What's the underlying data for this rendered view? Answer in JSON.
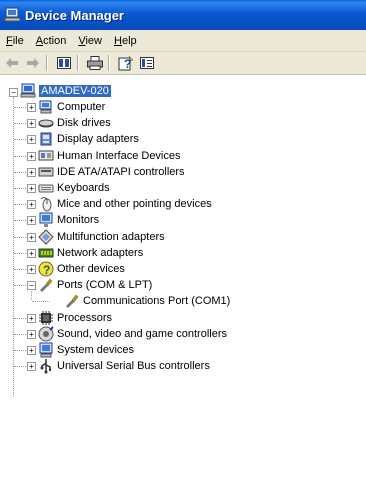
{
  "window": {
    "title": "Device Manager"
  },
  "menu": [
    {
      "label_first": "F",
      "label_rest": "ile"
    },
    {
      "label_first": "A",
      "label_rest": "ction"
    },
    {
      "label_first": "V",
      "label_rest": "iew"
    },
    {
      "label_first": "H",
      "label_rest": "elp"
    }
  ],
  "toolbar": {
    "buttons": [
      "back-icon",
      "forward-icon",
      "properties-icon",
      "print-icon",
      "help-icon",
      "view-icon"
    ]
  },
  "tree": {
    "root": "AMADEV-020",
    "nodes": [
      {
        "label": "Computer",
        "icon": "computer-icon",
        "expanded": false
      },
      {
        "label": "Disk drives",
        "icon": "disk-drive-icon",
        "expanded": false
      },
      {
        "label": "Display adapters",
        "icon": "display-adapter-icon",
        "expanded": false
      },
      {
        "label": "Human Interface Devices",
        "icon": "hid-icon",
        "expanded": false
      },
      {
        "label": "IDE ATA/ATAPI controllers",
        "icon": "ide-controller-icon",
        "expanded": false
      },
      {
        "label": "Keyboards",
        "icon": "keyboard-icon",
        "expanded": false
      },
      {
        "label": "Mice and other pointing devices",
        "icon": "mouse-icon",
        "expanded": false
      },
      {
        "label": "Monitors",
        "icon": "monitor-icon",
        "expanded": false
      },
      {
        "label": "Multifunction adapters",
        "icon": "multifunction-icon",
        "expanded": false
      },
      {
        "label": "Network adapters",
        "icon": "network-adapter-icon",
        "expanded": false
      },
      {
        "label": "Other devices",
        "icon": "other-devices-icon",
        "expanded": false
      },
      {
        "label": "Ports (COM & LPT)",
        "icon": "port-icon",
        "expanded": true,
        "children": [
          {
            "label": "Communications Port (COM1)",
            "icon": "port-icon"
          }
        ]
      },
      {
        "label": "Processors",
        "icon": "processor-icon",
        "expanded": false
      },
      {
        "label": "Sound, video and game controllers",
        "icon": "sound-icon",
        "expanded": false
      },
      {
        "label": "System devices",
        "icon": "system-devices-icon",
        "expanded": false
      },
      {
        "label": "Universal Serial Bus controllers",
        "icon": "usb-icon",
        "expanded": false
      }
    ]
  },
  "colors": {
    "titlebar": "#0a58d2",
    "selection": "#316ac5",
    "chrome": "#ece9d8"
  }
}
